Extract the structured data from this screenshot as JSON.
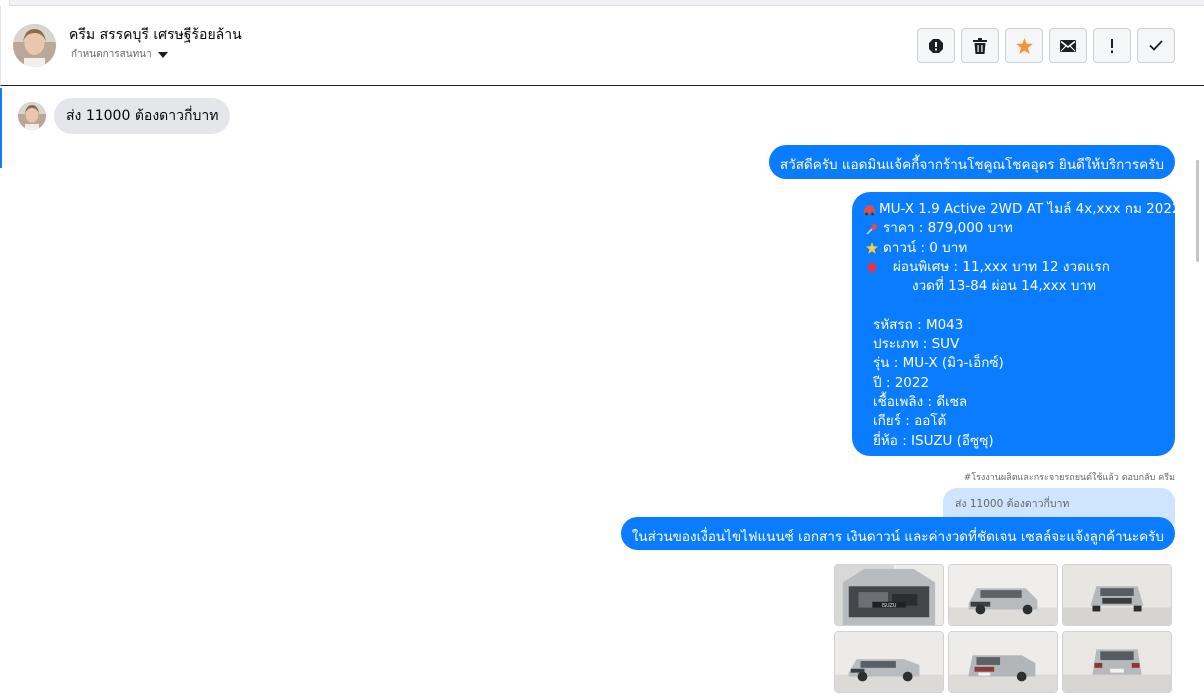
{
  "header": {
    "contact_name": "ครีม สรรคบุรี เศรษฐีร้อยล้าน",
    "conversation_menu": "กำหนดการสนทนา"
  },
  "actions": [
    {
      "name": "report-icon",
      "label": "!"
    },
    {
      "name": "trash-icon",
      "label": ""
    },
    {
      "name": "star-icon",
      "label": ""
    },
    {
      "name": "mail-icon",
      "label": ""
    },
    {
      "name": "important-icon",
      "label": "!"
    },
    {
      "name": "check-icon",
      "label": ""
    }
  ],
  "messages": {
    "incoming_1": "ส่ง 11000 ต้องดาวกี่บาท",
    "outgoing_1": "สวัสดีครับ แอดมินแจ้คกี้จากร้านโชคูณโชคอุดร ยินดีให้บริการครับ",
    "outgoing_2": {
      "title": "MU-X 1.9 Active 2WD AT ไมล์ 4x,xxx กม 2022",
      "price": "ราคา : 879,000 บาท",
      "down": "ดาวน์ : 0 บาท",
      "special": "ผ่อนพิเศษ : 11,xxx บาท 12 งวดแรก",
      "special_2": "งวดที่ 13-84 ผ่อน 14,xxx บาท",
      "code": "รหัสรถ : M043",
      "type": "ประเภท : SUV",
      "model": "รุ่น : MU-X (มิว-เอ็กซ์)",
      "year": "ปี : 2022",
      "fuel": "เชื้อเพลิง : ดีเซล",
      "gear": "เกียร์ : ออโต้",
      "brand": "ยี่ห้อ : ISUZU (อีซูซุ)"
    },
    "reply_note": "#โรงงานผลิตและกระจายรถยนต์ใช้แล้ว ตอบกลับ ครีม",
    "quoted": "ส่ง 11000 ต้องดาวกี่บาท",
    "outgoing_3": "ในส่วนของเงื่อนไขไฟแนนซ์ เอกสาร เงินดาวน์ และค่างวดที่ชัดเจน เซลล์จะแจ้งลูกค้านะครับ"
  },
  "colors": {
    "bubble_out": "#0a7cff",
    "bubble_in": "#e4e6eb",
    "star": "#f7923b"
  },
  "gallery": [
    {
      "name": "car-engine-photo"
    },
    {
      "name": "car-front-left-photo"
    },
    {
      "name": "car-front-photo"
    },
    {
      "name": "car-side-photo"
    },
    {
      "name": "car-rear-left-photo"
    },
    {
      "name": "car-rear-photo"
    }
  ]
}
